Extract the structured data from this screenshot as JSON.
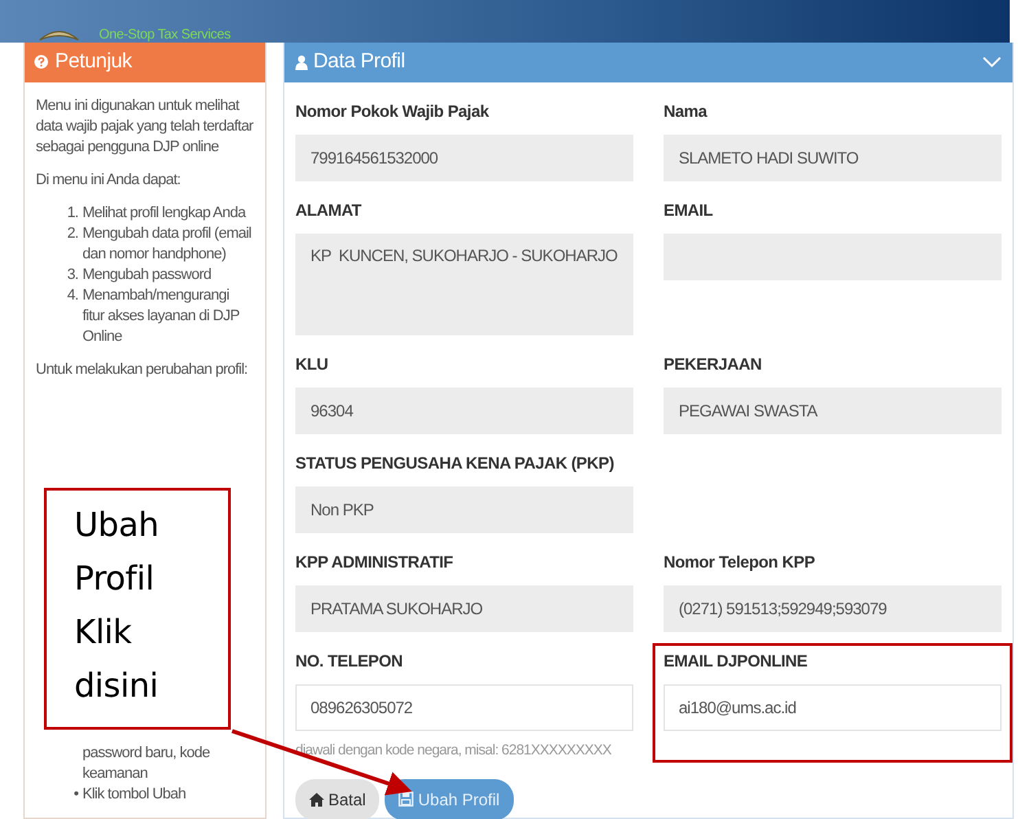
{
  "header": {
    "tagline": "One-Stop Tax Services"
  },
  "sidebar": {
    "title": "Petunjuk",
    "intro": [
      "Menu ini digunakan untuk melihat data wajib pajak yang telah terdaftar sebagai pengguna DJP online",
      "Di menu ini Anda dapat:"
    ],
    "steps": [
      {
        "marker": "1.",
        "text": "Melihat profil lengkap Anda"
      },
      {
        "marker": "2.",
        "text": "Mengubah data profil (email dan nomor handphone)"
      },
      {
        "marker": "3.",
        "text": "Mengubah password"
      },
      {
        "marker": "4.",
        "text": "Menambah/mengurangi fitur akses layanan di DJP Online"
      }
    ],
    "change_intro": "Untuk melakukan perubahan profil:",
    "bullets": [
      {
        "text": "password baru, kode keamanan"
      },
      {
        "marker": "•",
        "text": "Klik tombol Ubah"
      }
    ]
  },
  "panel": {
    "title": "Data Profil",
    "collapsed": false,
    "rows": [
      [
        {
          "label": "Nomor Pokok Wajib Pajak",
          "value": "799164561532000",
          "kind": "readonly"
        },
        {
          "label": "Nama",
          "value": "SLAMETO HADI SUWITO",
          "kind": "readonly"
        }
      ],
      [
        {
          "label": "ALAMAT",
          "value": "KP  KUNCEN, SUKOHARJO - SUKOHARJO",
          "kind": "textarea"
        },
        {
          "label": "EMAIL",
          "kind": "readonly"
        }
      ],
      [
        {
          "label": "KLU",
          "value": "96304",
          "kind": "readonly"
        },
        {
          "label": "PEKERJAAN",
          "value": "PEGAWAI SWASTA",
          "kind": "readonly"
        }
      ],
      [
        {
          "label": "STATUS PENGUSAHA KENA PAJAK (PKP)",
          "value": "Non PKP",
          "kind": "readonly"
        }
      ],
      [
        {
          "label": "KPP ADMINISTRATIF",
          "value": "PRATAMA SUKOHARJO",
          "kind": "readonly"
        },
        {
          "label": "Nomor Telepon KPP",
          "value": "(0271) 591513;592949;593079",
          "kind": "readonly"
        }
      ],
      [
        {
          "label": "NO. TELEPON",
          "value": "089626305072",
          "kind": "editable",
          "help": "diawali dengan kode negara, misal: 6281XXXXXXXXX"
        },
        {
          "label": "EMAIL DJPONLINE",
          "value": "ai180@ums.ac.id",
          "kind": "editable",
          "highlighted": true
        }
      ]
    ],
    "buttons": [
      {
        "label": "Batal",
        "kind": "default"
      },
      {
        "label": "Ubah Profil",
        "kind": "primary"
      }
    ]
  },
  "callout": {
    "lines": [
      "Ubah",
      "Profil",
      "Klik",
      "disini"
    ]
  }
}
